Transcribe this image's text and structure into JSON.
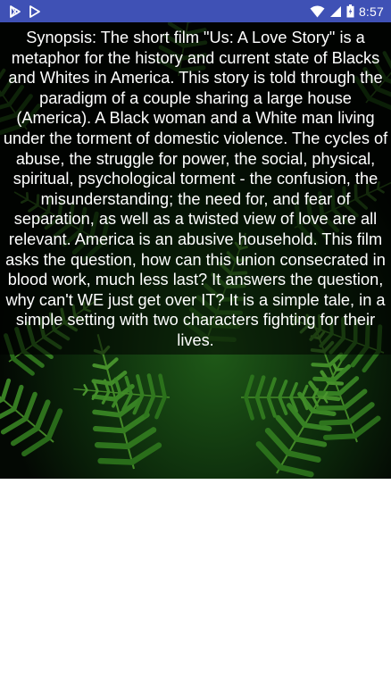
{
  "status_bar": {
    "time": "8:57",
    "background": "#3f51b5",
    "left_icons": [
      "play-store-notification-icon",
      "play-triangle-notification-icon"
    ],
    "right_icons": [
      "wifi-icon",
      "cell-signal-icon",
      "battery-icon"
    ]
  },
  "content": {
    "synopsis": "Synopsis: The short film \"Us: A Love Story\" is a metaphor for the history and current state of Blacks and Whites in America. This story is told through the paradigm of a couple sharing a large house (America). A Black woman and a White man living under the torment of domestic violence. The cycles of abuse, the struggle for power, the social, physical, spiritual, psychological torment - the confusion, the misunderstanding; the need for, and fear of separation, as well as a twisted view of love are all relevant. America is an abusive household. This film asks the question, how can this union consecrated in blood work, much less last? It answers the question, why can't WE just get over IT? It is a simple tale, in a simple setting with two characters fighting for their lives.",
    "text_color": "#ffffff",
    "background_image": "fern-leaves-image"
  }
}
